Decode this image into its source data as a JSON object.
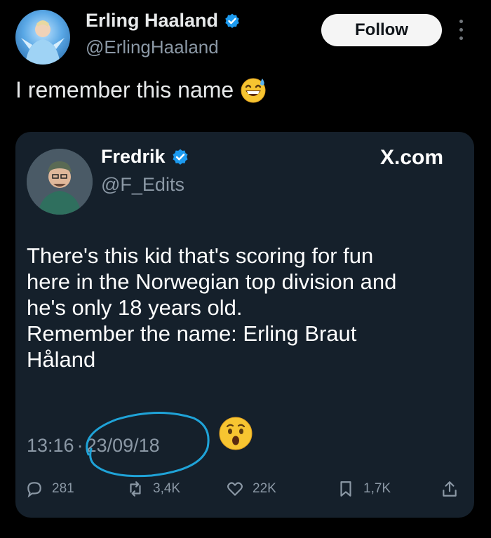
{
  "author": {
    "display_name": "Erling Haaland",
    "handle": "@ErlingHaaland"
  },
  "follow_label": "Follow",
  "tweet_text": "I remember this name",
  "quoted": {
    "display_name": "Fredrik",
    "handle": "@F_Edits",
    "source": "X.com",
    "lines": [
      "There's this kid that's scoring for fun",
      "here in the Norwegian top division and",
      "he's only 18 years old.",
      "Remember the name: Erling Braut",
      "Håland"
    ],
    "time": "13:16",
    "separator": "·",
    "date": "23/09/18",
    "replies": "281",
    "reposts": "3,4K",
    "likes": "22K",
    "bookmarks": "1,7K"
  },
  "colors": {
    "background": "#000000",
    "card": "#15202b",
    "verified": "#1d9bf0",
    "annotation": "#1fa3d8",
    "muted": "#8b98a5"
  },
  "icons": [
    "verified-badge-icon",
    "more-options-icon",
    "grinning-sweat-emoji",
    "hushed-face-emoji",
    "reply-icon",
    "repost-icon",
    "like-icon",
    "bookmark-icon",
    "share-icon"
  ]
}
